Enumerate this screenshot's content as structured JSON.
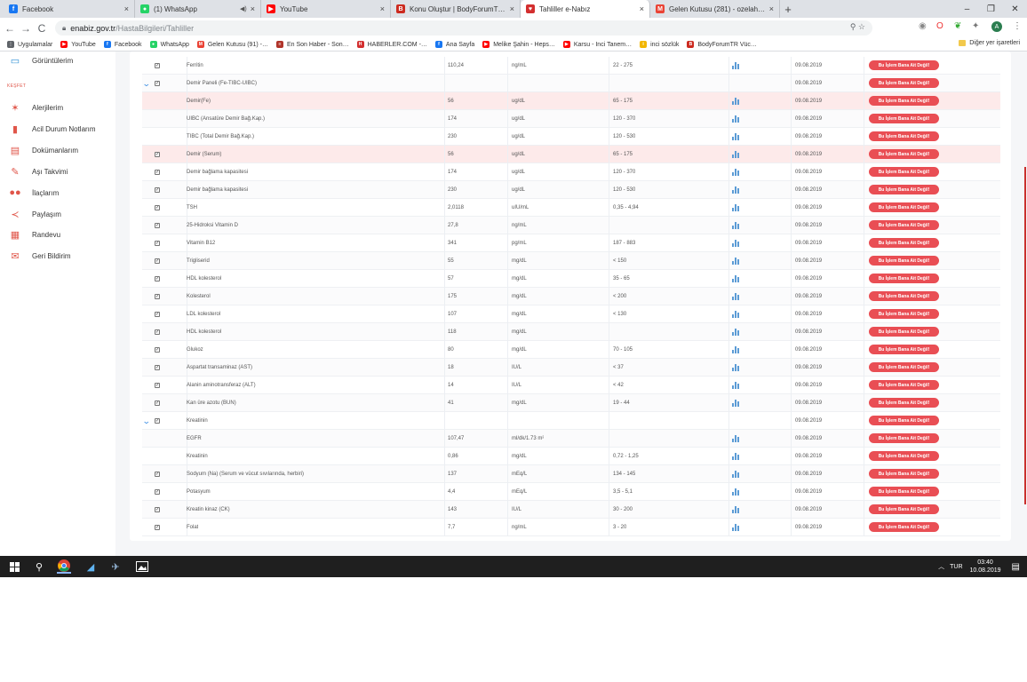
{
  "browser": {
    "tabs": [
      {
        "title": "Facebook",
        "favicon_color": "#1877f2",
        "glyph": "f",
        "width": 148,
        "close": "×"
      },
      {
        "title": "(1) WhatsApp",
        "favicon_color": "#25d366",
        "glyph": "●",
        "width": 142,
        "close": "×",
        "sound": "◀)"
      },
      {
        "title": "YouTube",
        "favicon_color": "#ff0000",
        "glyph": "▶",
        "width": 146,
        "close": "×"
      },
      {
        "title": "Konu Oluştur | BodyForumTR Vü…",
        "favicon_color": "#cc2a1f",
        "glyph": "B",
        "width": 146,
        "close": "×"
      },
      {
        "title": "Tahliller e-Nabız",
        "favicon_color": "#d32f2f",
        "glyph": "♥",
        "width": 146,
        "close": "×",
        "active": true
      },
      {
        "title": "Gelen Kutusu (281) - ozelahmet1…",
        "favicon_color": "#ea4335",
        "glyph": "M",
        "width": 146,
        "close": "×"
      }
    ],
    "new_tab": "+",
    "window_controls": [
      "–",
      "❐",
      "✕"
    ],
    "nav": {
      "back": "←",
      "forward": "→",
      "reload": "C"
    },
    "url_host": "enabiz.gov.tr",
    "url_path": "/HastaBilgileri/Tahliller",
    "omni_icons": "⚲  ☆",
    "bookmarks": [
      {
        "label": "Uygulamalar",
        "color": "#5f6368",
        "glyph": "⋮"
      },
      {
        "label": "YouTube",
        "color": "#ff0000",
        "glyph": "▶"
      },
      {
        "label": "Facebook",
        "color": "#1877f2",
        "glyph": "f"
      },
      {
        "label": "WhatsApp",
        "color": "#25d366",
        "glyph": "●"
      },
      {
        "label": "Gelen Kutusu (91) -…",
        "color": "#ea4335",
        "glyph": "M"
      },
      {
        "label": "En Son Haber - Son…",
        "color": "#b0342a",
        "glyph": "≡"
      },
      {
        "label": "HABERLER.COM -…",
        "color": "#d32f2f",
        "glyph": "H"
      },
      {
        "label": "Ana Sayfa",
        "color": "#1877f2",
        "glyph": "f"
      },
      {
        "label": "Melike Şahin - Heps…",
        "color": "#ff0000",
        "glyph": "▶"
      },
      {
        "label": "Karsu - Inci Tanem…",
        "color": "#ff0000",
        "glyph": "▶"
      },
      {
        "label": "inci sözlük",
        "color": "#f2b600",
        "glyph": "i"
      },
      {
        "label": "BodyForumTR Vüc…",
        "color": "#cc2a1f",
        "glyph": "B"
      }
    ],
    "other_bookmarks": "Diğer yer işaretleri"
  },
  "sidebar": {
    "section_caption": "KEŞFET",
    "items": [
      {
        "label": "Görüntülerim",
        "icon": "image-icon",
        "glyph": "▭",
        "color": "#2d8fd5"
      },
      {
        "label": "Alerjilerim",
        "icon": "allergy-icon",
        "glyph": "✶",
        "color": "#e0564a"
      },
      {
        "label": "Acil Durum Notlarım",
        "icon": "emergency-note-icon",
        "glyph": "▮",
        "color": "#e0564a"
      },
      {
        "label": "Dokümanlarım",
        "icon": "document-icon",
        "glyph": "▤",
        "color": "#e0564a"
      },
      {
        "label": "Aşı Takvimi",
        "icon": "vaccine-icon",
        "glyph": "✎",
        "color": "#e0564a"
      },
      {
        "label": "İlaçlarım",
        "icon": "pill-icon",
        "glyph": "●●",
        "color": "#e0564a"
      },
      {
        "label": "Paylaşım",
        "icon": "share-icon",
        "glyph": "≺",
        "color": "#e0564a"
      },
      {
        "label": "Randevu",
        "icon": "calendar-icon",
        "glyph": "▦",
        "color": "#e0564a"
      },
      {
        "label": "Geri Bildirim",
        "icon": "mail-icon",
        "glyph": "✉",
        "color": "#e0564a"
      }
    ]
  },
  "table": {
    "action_label": "Bu İşlem Bana Ait Değil!",
    "checkmark": "✓",
    "expand_glyph": "⌄",
    "rows": [
      {
        "test": "Ferritin",
        "result": "110,24",
        "unit": "ng/mL",
        "range": "22 - 275",
        "date": "09.08.2019",
        "check": true,
        "chart": true
      },
      {
        "test": "Demir Paneli (Fe-TIBC-UIBC)",
        "result": "",
        "unit": "",
        "range": "",
        "date": "09.08.2019",
        "check": true,
        "chart": false,
        "group": true
      },
      {
        "test": "Demir(Fe)",
        "result": "56",
        "unit": "ug/dL",
        "range": "65 - 175",
        "date": "09.08.2019",
        "check": false,
        "chart": true,
        "highlight": true
      },
      {
        "test": "UIBC (Ansatüre Demir Bağ.Kap.)",
        "result": "174",
        "unit": "ug/dL",
        "range": "120 - 370",
        "date": "09.08.2019",
        "check": false,
        "chart": true
      },
      {
        "test": "TIBC (Total Demir Bağ.Kap.)",
        "result": "230",
        "unit": "ug/dL",
        "range": "120 - 530",
        "date": "09.08.2019",
        "check": false,
        "chart": true
      },
      {
        "test": "Demir (Serum)",
        "result": "56",
        "unit": "ug/dL",
        "range": "65 - 175",
        "date": "09.08.2019",
        "check": true,
        "chart": true,
        "highlight": true
      },
      {
        "test": "Demir bağlama kapasitesi",
        "result": "174",
        "unit": "ug/dL",
        "range": "120 - 370",
        "date": "09.08.2019",
        "check": true,
        "chart": true
      },
      {
        "test": "Demir bağlama kapasitesi",
        "result": "230",
        "unit": "ug/dL",
        "range": "120 - 530",
        "date": "09.08.2019",
        "check": true,
        "chart": true
      },
      {
        "test": "TSH",
        "result": "2,0118",
        "unit": "uIU/mL",
        "range": "0,35 - 4,94",
        "date": "09.08.2019",
        "check": true,
        "chart": true
      },
      {
        "test": "25-Hidroksi Vitamin D",
        "result": "27,8",
        "unit": "ng/mL",
        "range": "",
        "date": "09.08.2019",
        "check": true,
        "chart": true
      },
      {
        "test": "Vitamin B12",
        "result": "341",
        "unit": "pg/mL",
        "range": "187 - 883",
        "date": "09.08.2019",
        "check": true,
        "chart": true
      },
      {
        "test": "Trigliserid",
        "result": "55",
        "unit": "mg/dL",
        "range": "< 150",
        "date": "09.08.2019",
        "check": true,
        "chart": true
      },
      {
        "test": "HDL kolesterol",
        "result": "57",
        "unit": "mg/dL",
        "range": "35 - 65",
        "date": "09.08.2019",
        "check": true,
        "chart": true
      },
      {
        "test": "Kolesterol",
        "result": "175",
        "unit": "mg/dL",
        "range": "< 200",
        "date": "09.08.2019",
        "check": true,
        "chart": true
      },
      {
        "test": "LDL kolesterol",
        "result": "107",
        "unit": "mg/dL",
        "range": "< 130",
        "date": "09.08.2019",
        "check": true,
        "chart": true
      },
      {
        "test": "HDL kolesterol",
        "result": "118",
        "unit": "mg/dL",
        "range": "",
        "date": "09.08.2019",
        "check": true,
        "chart": true
      },
      {
        "test": "Glukoz",
        "result": "80",
        "unit": "mg/dL",
        "range": "70 - 105",
        "date": "09.08.2019",
        "check": true,
        "chart": true
      },
      {
        "test": "Aspartat transaminaz (AST)",
        "result": "18",
        "unit": "IU/L",
        "range": "< 37",
        "date": "09.08.2019",
        "check": true,
        "chart": true
      },
      {
        "test": "Alanin aminotransferaz (ALT)",
        "result": "14",
        "unit": "IU/L",
        "range": "< 42",
        "date": "09.08.2019",
        "check": true,
        "chart": true
      },
      {
        "test": "Kan üre azotu (BUN)",
        "result": "41",
        "unit": "mg/dL",
        "range": "19 - 44",
        "date": "09.08.2019",
        "check": true,
        "chart": true
      },
      {
        "test": "Kreatinin",
        "result": "",
        "unit": "",
        "range": "",
        "date": "09.08.2019",
        "check": true,
        "chart": false,
        "group": true
      },
      {
        "test": "EGFR",
        "result": "107,47",
        "unit": "ml/dk/1.73 m²",
        "range": "",
        "date": "09.08.2019",
        "check": false,
        "chart": true
      },
      {
        "test": "Kreatinin",
        "result": "0,86",
        "unit": "mg/dL",
        "range": "0,72 - 1,25",
        "date": "09.08.2019",
        "check": false,
        "chart": true
      },
      {
        "test": "Sodyum (Na) (Serum ve vücut sıvılarında, herbiri)",
        "result": "137",
        "unit": "mEq/L",
        "range": "134 - 145",
        "date": "09.08.2019",
        "check": true,
        "chart": true
      },
      {
        "test": "Potasyum",
        "result": "4,4",
        "unit": "mEq/L",
        "range": "3,5 - 5,1",
        "date": "09.08.2019",
        "check": true,
        "chart": true
      },
      {
        "test": "Kreatin kinaz (CK)",
        "result": "143",
        "unit": "IU/L",
        "range": "30 - 200",
        "date": "09.08.2019",
        "check": true,
        "chart": true
      },
      {
        "test": "Folat",
        "result": "7,7",
        "unit": "ng/mL",
        "range": "3 - 20",
        "date": "09.08.2019",
        "check": true,
        "chart": true
      }
    ]
  },
  "taskbar": {
    "lang": "TUR",
    "time": "03:40",
    "date": "10.08.2019",
    "tray_arrow": "︿"
  }
}
